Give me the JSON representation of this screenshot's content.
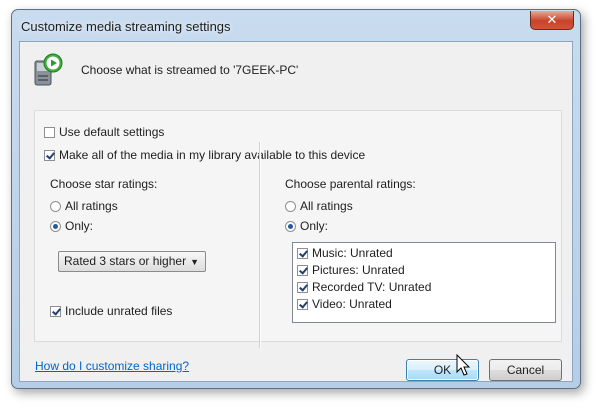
{
  "window": {
    "title": "Customize media streaming settings",
    "close_label": "✕"
  },
  "header": {
    "text": "Choose what is streamed to '7GEEK-PC'"
  },
  "options": {
    "use_default": {
      "label": "Use default settings",
      "checked": false
    },
    "make_all_available": {
      "label": "Make all of the media in my library available to this device",
      "checked": true
    }
  },
  "star_ratings": {
    "heading": "Choose star ratings:",
    "all_label": "All ratings",
    "only_label": "Only:",
    "selected": "Only",
    "dropdown_value": "Rated 3 stars or higher",
    "include_unrated": {
      "label": "Include unrated files",
      "checked": true
    }
  },
  "parental_ratings": {
    "heading": "Choose parental ratings:",
    "all_label": "All ratings",
    "only_label": "Only:",
    "selected": "Only",
    "items": [
      {
        "label": "Music: Unrated",
        "checked": true
      },
      {
        "label": "Pictures: Unrated",
        "checked": true
      },
      {
        "label": "Recorded TV: Unrated",
        "checked": true
      },
      {
        "label": "Video: Unrated",
        "checked": true
      }
    ]
  },
  "footer": {
    "help_link": "How do I customize sharing?",
    "ok_label": "OK",
    "cancel_label": "Cancel"
  },
  "colors": {
    "title_bar": "#c9dcef",
    "close_button": "#c7432a",
    "link": "#0066cc",
    "checkmark": "#21406e"
  }
}
